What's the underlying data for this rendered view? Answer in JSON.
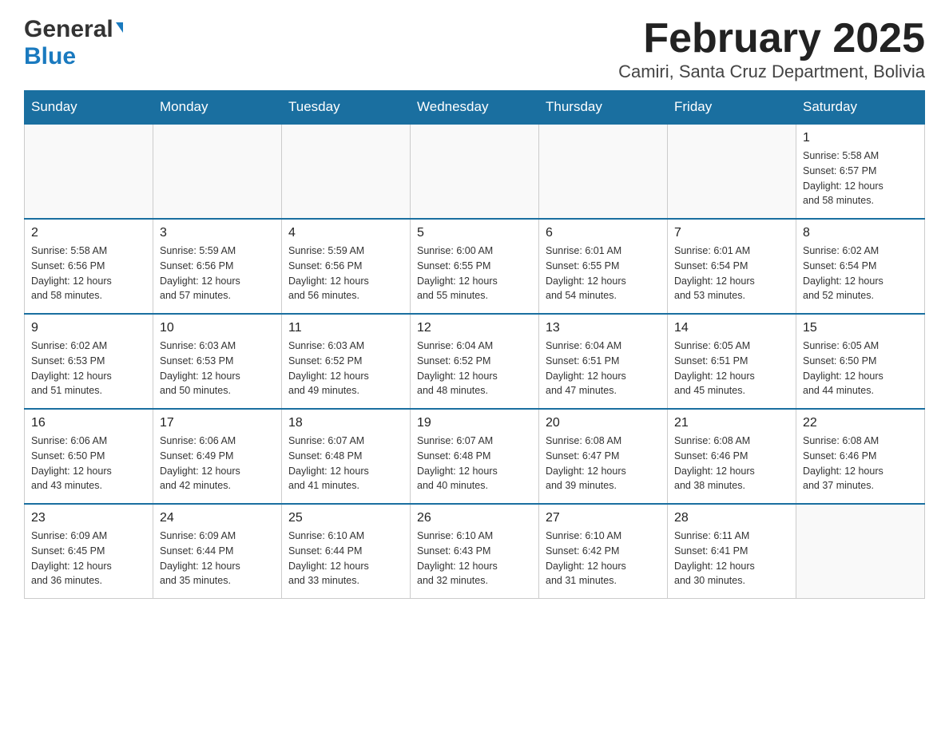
{
  "logo": {
    "general": "General",
    "blue": "Blue"
  },
  "title": "February 2025",
  "subtitle": "Camiri, Santa Cruz Department, Bolivia",
  "weekdays": [
    "Sunday",
    "Monday",
    "Tuesday",
    "Wednesday",
    "Thursday",
    "Friday",
    "Saturday"
  ],
  "weeks": [
    [
      {
        "num": "",
        "info": ""
      },
      {
        "num": "",
        "info": ""
      },
      {
        "num": "",
        "info": ""
      },
      {
        "num": "",
        "info": ""
      },
      {
        "num": "",
        "info": ""
      },
      {
        "num": "",
        "info": ""
      },
      {
        "num": "1",
        "info": "Sunrise: 5:58 AM\nSunset: 6:57 PM\nDaylight: 12 hours\nand 58 minutes."
      }
    ],
    [
      {
        "num": "2",
        "info": "Sunrise: 5:58 AM\nSunset: 6:56 PM\nDaylight: 12 hours\nand 58 minutes."
      },
      {
        "num": "3",
        "info": "Sunrise: 5:59 AM\nSunset: 6:56 PM\nDaylight: 12 hours\nand 57 minutes."
      },
      {
        "num": "4",
        "info": "Sunrise: 5:59 AM\nSunset: 6:56 PM\nDaylight: 12 hours\nand 56 minutes."
      },
      {
        "num": "5",
        "info": "Sunrise: 6:00 AM\nSunset: 6:55 PM\nDaylight: 12 hours\nand 55 minutes."
      },
      {
        "num": "6",
        "info": "Sunrise: 6:01 AM\nSunset: 6:55 PM\nDaylight: 12 hours\nand 54 minutes."
      },
      {
        "num": "7",
        "info": "Sunrise: 6:01 AM\nSunset: 6:54 PM\nDaylight: 12 hours\nand 53 minutes."
      },
      {
        "num": "8",
        "info": "Sunrise: 6:02 AM\nSunset: 6:54 PM\nDaylight: 12 hours\nand 52 minutes."
      }
    ],
    [
      {
        "num": "9",
        "info": "Sunrise: 6:02 AM\nSunset: 6:53 PM\nDaylight: 12 hours\nand 51 minutes."
      },
      {
        "num": "10",
        "info": "Sunrise: 6:03 AM\nSunset: 6:53 PM\nDaylight: 12 hours\nand 50 minutes."
      },
      {
        "num": "11",
        "info": "Sunrise: 6:03 AM\nSunset: 6:52 PM\nDaylight: 12 hours\nand 49 minutes."
      },
      {
        "num": "12",
        "info": "Sunrise: 6:04 AM\nSunset: 6:52 PM\nDaylight: 12 hours\nand 48 minutes."
      },
      {
        "num": "13",
        "info": "Sunrise: 6:04 AM\nSunset: 6:51 PM\nDaylight: 12 hours\nand 47 minutes."
      },
      {
        "num": "14",
        "info": "Sunrise: 6:05 AM\nSunset: 6:51 PM\nDaylight: 12 hours\nand 45 minutes."
      },
      {
        "num": "15",
        "info": "Sunrise: 6:05 AM\nSunset: 6:50 PM\nDaylight: 12 hours\nand 44 minutes."
      }
    ],
    [
      {
        "num": "16",
        "info": "Sunrise: 6:06 AM\nSunset: 6:50 PM\nDaylight: 12 hours\nand 43 minutes."
      },
      {
        "num": "17",
        "info": "Sunrise: 6:06 AM\nSunset: 6:49 PM\nDaylight: 12 hours\nand 42 minutes."
      },
      {
        "num": "18",
        "info": "Sunrise: 6:07 AM\nSunset: 6:48 PM\nDaylight: 12 hours\nand 41 minutes."
      },
      {
        "num": "19",
        "info": "Sunrise: 6:07 AM\nSunset: 6:48 PM\nDaylight: 12 hours\nand 40 minutes."
      },
      {
        "num": "20",
        "info": "Sunrise: 6:08 AM\nSunset: 6:47 PM\nDaylight: 12 hours\nand 39 minutes."
      },
      {
        "num": "21",
        "info": "Sunrise: 6:08 AM\nSunset: 6:46 PM\nDaylight: 12 hours\nand 38 minutes."
      },
      {
        "num": "22",
        "info": "Sunrise: 6:08 AM\nSunset: 6:46 PM\nDaylight: 12 hours\nand 37 minutes."
      }
    ],
    [
      {
        "num": "23",
        "info": "Sunrise: 6:09 AM\nSunset: 6:45 PM\nDaylight: 12 hours\nand 36 minutes."
      },
      {
        "num": "24",
        "info": "Sunrise: 6:09 AM\nSunset: 6:44 PM\nDaylight: 12 hours\nand 35 minutes."
      },
      {
        "num": "25",
        "info": "Sunrise: 6:10 AM\nSunset: 6:44 PM\nDaylight: 12 hours\nand 33 minutes."
      },
      {
        "num": "26",
        "info": "Sunrise: 6:10 AM\nSunset: 6:43 PM\nDaylight: 12 hours\nand 32 minutes."
      },
      {
        "num": "27",
        "info": "Sunrise: 6:10 AM\nSunset: 6:42 PM\nDaylight: 12 hours\nand 31 minutes."
      },
      {
        "num": "28",
        "info": "Sunrise: 6:11 AM\nSunset: 6:41 PM\nDaylight: 12 hours\nand 30 minutes."
      },
      {
        "num": "",
        "info": ""
      }
    ]
  ]
}
